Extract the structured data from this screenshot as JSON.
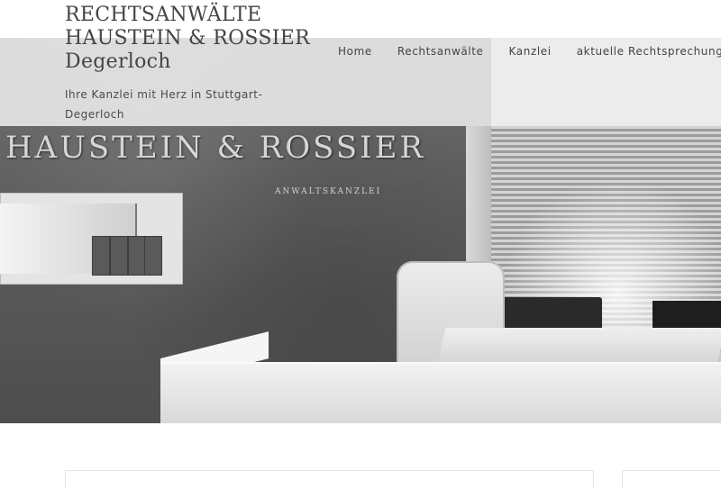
{
  "site": {
    "title_line1": "RECHTSANWÄLTE",
    "title_line2": "HAUSTEIN & ROSSIER",
    "title_line3": "Degerloch",
    "tagline": "Ihre Kanzlei mit Herz in Stuttgart-Degerloch"
  },
  "nav": {
    "items": [
      {
        "label": "Home"
      },
      {
        "label": "Rechtsanwälte"
      },
      {
        "label": "Kanzlei"
      },
      {
        "label": "aktuelle Rechtsprechung"
      }
    ]
  },
  "hero": {
    "sign_text": "HAUSTEIN & ROSSIER",
    "sign_subtext": "ANWALTSKANZLEI"
  },
  "colors": {
    "header_overlay": "#ececec",
    "text": "#444444"
  }
}
